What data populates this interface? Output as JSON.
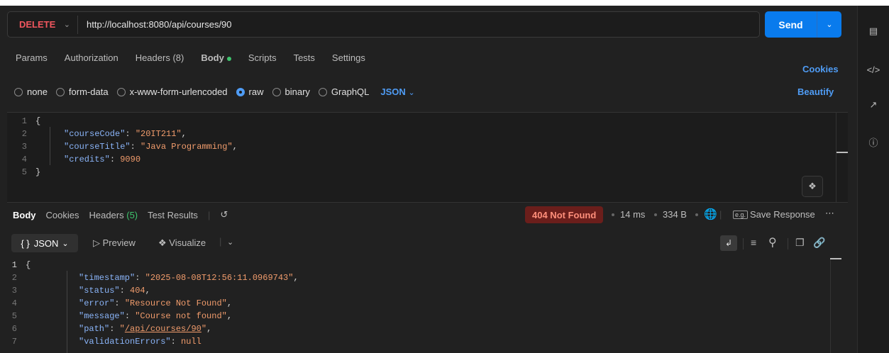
{
  "request": {
    "method": "DELETE",
    "url": "http://localhost:8080/api/courses/90",
    "send_label": "Send"
  },
  "request_tabs": {
    "params": "Params",
    "authorization": "Authorization",
    "headers_label": "Headers",
    "headers_count": "(8)",
    "body": "Body",
    "scripts": "Scripts",
    "tests": "Tests",
    "settings": "Settings",
    "cookies": "Cookies",
    "beautify": "Beautify"
  },
  "body_types": {
    "none": "none",
    "form_data": "form-data",
    "urlencoded": "x-www-form-urlencoded",
    "raw": "raw",
    "binary": "binary",
    "graphql": "GraphQL",
    "format": "JSON"
  },
  "request_body": {
    "lines": [
      "1",
      "2",
      "3",
      "4",
      "5"
    ],
    "open_brace": "{",
    "close_brace": "}",
    "key1": "\"courseCode\"",
    "val1": "\"20IT211\"",
    "key2": "\"courseTitle\"",
    "val2": "\"Java Programming\"",
    "key3": "\"credits\"",
    "val3": "9090"
  },
  "response_tabs": {
    "body": "Body",
    "cookies": "Cookies",
    "headers_label": "Headers",
    "headers_count": "(5)",
    "test_results": "Test Results"
  },
  "response_meta": {
    "status": "404 Not Found",
    "time": "14 ms",
    "size": "334 B",
    "save_response": "Save Response",
    "eg_badge": "e.g."
  },
  "response_toolbar": {
    "format": "JSON",
    "preview": "Preview",
    "visualize": "Visualize"
  },
  "response_body": {
    "lines": [
      "1",
      "2",
      "3",
      "4",
      "5",
      "6",
      "7"
    ],
    "open_brace": "{",
    "k_timestamp": "\"timestamp\"",
    "v_timestamp": "\"2025-08-08T12:56:11.0969743\"",
    "k_status": "\"status\"",
    "v_status": "404",
    "k_error": "\"error\"",
    "v_error": "\"Resource Not Found\"",
    "k_message": "\"message\"",
    "v_message": "\"Course not found\"",
    "k_path": "\"path\"",
    "v_path": "\"/api/courses/90\"",
    "k_validation": "\"validationErrors\"",
    "v_validation": "null"
  },
  "colors": {
    "method": "#f0565e",
    "send": "#097bed",
    "accent_blue": "#4f9cf5",
    "green": "#3ec46d",
    "status_bg": "#6b1e1b",
    "status_fg": "#ff8f7b"
  }
}
